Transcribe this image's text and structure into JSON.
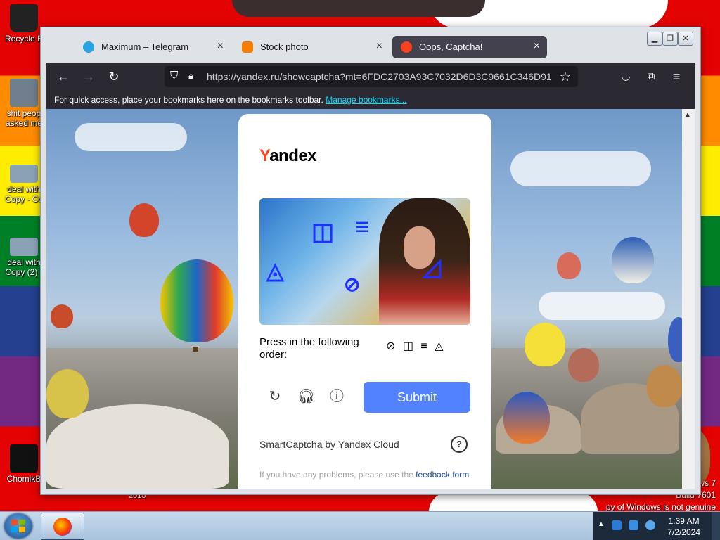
{
  "desktop": {
    "icons": [
      {
        "label": "Recycle B",
        "color": "#222"
      },
      {
        "label": "shit peop asked me",
        "color": "#6f7d8c"
      },
      {
        "label": "deal with Copy - Co",
        "color": "#8aa2b5"
      },
      {
        "label": "deal with Copy (2) -",
        "color": "#8aa2b5"
      },
      {
        "label": "ChomikB",
        "color": "#111"
      }
    ],
    "year_label": "2015",
    "watermark_line1": "ws 7",
    "watermark_line2": "Build 7601",
    "watermark_line3": "py of Windows is not genuine"
  },
  "browser": {
    "tabs": [
      {
        "title": "Maximum – Telegram",
        "favicon": "telegram-icon",
        "favicon_color": "#2aa3e0",
        "active": false
      },
      {
        "title": "Stock photo",
        "favicon": "blogger-icon",
        "favicon_color": "#f57d00",
        "active": false
      },
      {
        "title": "Oops, Captcha!",
        "favicon": "yandex-icon",
        "favicon_color": "#fc3f1d",
        "active": true
      }
    ],
    "url": "https://yandex.ru/showcaptcha?mt=6FDC2703A93C7032D6D3C9661C346D91",
    "bookmarks_bar": {
      "text": "For quick access, place your bookmarks here on the bookmarks toolbar.",
      "link": "Manage bookmarks..."
    }
  },
  "captcha": {
    "logo_y": "Y",
    "logo_rest": "andex",
    "prompt": "Press in the following order:",
    "order_symbols": "⊘ ◫ ≡ ◬",
    "submit_label": "Submit",
    "brand": "SmartCaptcha by Yandex Cloud",
    "help": "?",
    "note_prefix": "If you have any problems, please use the",
    "note_link": "feedback form"
  },
  "taskbar": {
    "time": "1:39 AM",
    "date": "7/2/2024"
  },
  "colors": {
    "accent_button": "#5282ff",
    "browser_dark": "#2b2a33",
    "link": "#00ddff"
  }
}
